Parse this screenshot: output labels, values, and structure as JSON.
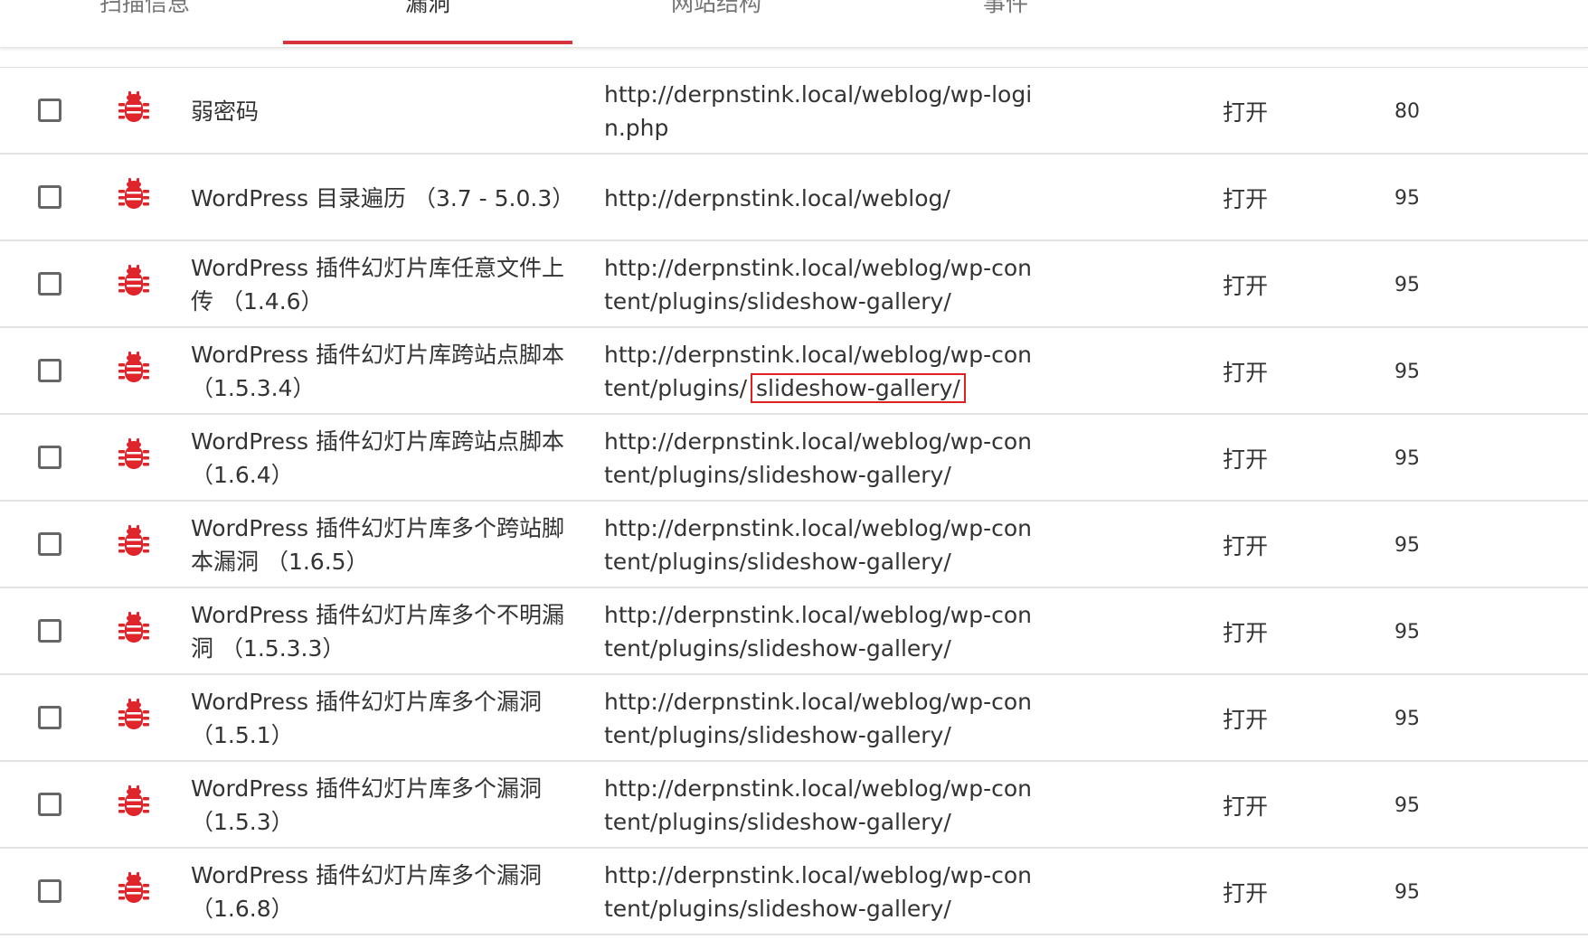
{
  "tabs": [
    {
      "label": "扫描信息",
      "active": false
    },
    {
      "label": "漏洞",
      "active": true
    },
    {
      "label": "网站结构",
      "active": false
    },
    {
      "label": "事件",
      "active": false
    }
  ],
  "colors": {
    "accent": "#d6333b",
    "bug_icon": "#e0242c",
    "highlight_box": "#e02020"
  },
  "vulnerabilities": [
    {
      "icon": "bug-icon",
      "name": "弱密码",
      "url_line1": "http://derpnstink.local/weblog/wp-logi",
      "url_line2": "n.php",
      "status": "打开",
      "score": "80"
    },
    {
      "icon": "bug-icon",
      "name": "WordPress 目录遍历 （3.7 - 5.0.3）",
      "url_line1": "http://derpnstink.local/weblog/",
      "url_line2": "",
      "status": "打开",
      "score": "95"
    },
    {
      "icon": "bug-icon",
      "name": "WordPress 插件幻灯片库任意文件上传 （1.4.6）",
      "url_line1": "http://derpnstink.local/weblog/wp-con",
      "url_line2": "tent/plugins/slideshow-gallery/",
      "status": "打开",
      "score": "95"
    },
    {
      "icon": "bug-icon",
      "name": "WordPress 插件幻灯片库跨站点脚本 （1.5.3.4）",
      "url_line1": "http://derpnstink.local/weblog/wp-con",
      "url_line2a": "tent/plugins/",
      "url_line2b": "slideshow-gallery/",
      "status": "打开",
      "score": "95"
    },
    {
      "icon": "bug-icon",
      "name": "WordPress 插件幻灯片库跨站点脚本 （1.6.4）",
      "url_line1": "http://derpnstink.local/weblog/wp-con",
      "url_line2": "tent/plugins/slideshow-gallery/",
      "status": "打开",
      "score": "95"
    },
    {
      "icon": "bug-icon",
      "name": "WordPress 插件幻灯片库多个跨站脚本漏洞 （1.6.5）",
      "url_line1": "http://derpnstink.local/weblog/wp-con",
      "url_line2": "tent/plugins/slideshow-gallery/",
      "status": "打开",
      "score": "95"
    },
    {
      "icon": "bug-icon",
      "name": "WordPress 插件幻灯片库多个不明漏洞 （1.5.3.3）",
      "url_line1": "http://derpnstink.local/weblog/wp-con",
      "url_line2": "tent/plugins/slideshow-gallery/",
      "status": "打开",
      "score": "95"
    },
    {
      "icon": "bug-icon",
      "name": "WordPress 插件幻灯片库多个漏洞 （1.5.1）",
      "url_line1": "http://derpnstink.local/weblog/wp-con",
      "url_line2": "tent/plugins/slideshow-gallery/",
      "status": "打开",
      "score": "95"
    },
    {
      "icon": "bug-icon",
      "name": "WordPress 插件幻灯片库多个漏洞 （1.5.3）",
      "url_line1": "http://derpnstink.local/weblog/wp-con",
      "url_line2": "tent/plugins/slideshow-gallery/",
      "status": "打开",
      "score": "95"
    },
    {
      "icon": "bug-icon",
      "name": "WordPress 插件幻灯片库多个漏洞 （1.6.8）",
      "url_line1": "http://derpnstink.local/weblog/wp-con",
      "url_line2": "tent/plugins/slideshow-gallery/",
      "status": "打开",
      "score": "95"
    }
  ]
}
